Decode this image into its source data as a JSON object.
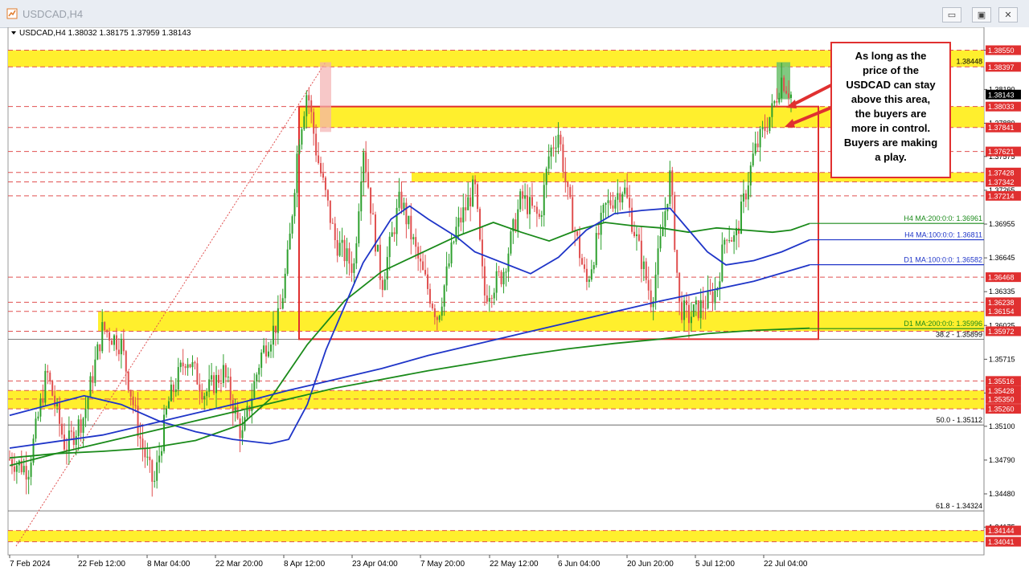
{
  "window": {
    "title": "USDCAD,H4",
    "buttons": {
      "minimize": "▭",
      "restore": "▣",
      "close": "✕"
    }
  },
  "chart_data": {
    "type": "candlestick",
    "symbol_header": "USDCAD,H4  1.38032 1.38175 1.37959 1.38143",
    "ylim": [
      1.3392,
      1.3876
    ],
    "x_ticks": [
      "7 Feb 2024",
      "22 Feb 12:00",
      "8 Mar 04:00",
      "22 Mar 20:00",
      "8 Apr 12:00",
      "23 Apr 04:00",
      "7 May 20:00",
      "22 May 12:00",
      "6 Jun 04:00",
      "20 Jun 20:00",
      "5 Jul 12:00",
      "22 Jul 04:00"
    ],
    "y_ticks": [
      "1.38550",
      "1.38190",
      "1.37880",
      "1.37575",
      "1.37265",
      "1.36955",
      "1.36645",
      "1.36335",
      "1.36025",
      "1.35715",
      "1.35405",
      "1.35100",
      "1.34790",
      "1.34480",
      "1.34175"
    ],
    "price_badges": [
      {
        "label": "1.38550",
        "value": 1.3855,
        "kind": "red"
      },
      {
        "label": "1.38397",
        "value": 1.38397,
        "kind": "red"
      },
      {
        "label": "1.38143",
        "value": 1.38143,
        "kind": "current"
      },
      {
        "label": "1.38033",
        "value": 1.38033,
        "kind": "red"
      },
      {
        "label": "1.37841",
        "value": 1.37841,
        "kind": "red"
      },
      {
        "label": "1.37621",
        "value": 1.37621,
        "kind": "red"
      },
      {
        "label": "1.37428",
        "value": 1.37428,
        "kind": "red"
      },
      {
        "label": "1.37342",
        "value": 1.37342,
        "kind": "red"
      },
      {
        "label": "1.37214",
        "value": 1.37214,
        "kind": "red"
      },
      {
        "label": "1.36468",
        "value": 1.36468,
        "kind": "red"
      },
      {
        "label": "1.36238",
        "value": 1.36238,
        "kind": "red"
      },
      {
        "label": "1.36154",
        "value": 1.36154,
        "kind": "red"
      },
      {
        "label": "1.35972",
        "value": 1.35972,
        "kind": "red"
      },
      {
        "label": "1.35516",
        "value": 1.35516,
        "kind": "red"
      },
      {
        "label": "1.35428",
        "value": 1.35428,
        "kind": "red"
      },
      {
        "label": "1.35350",
        "value": 1.3535,
        "kind": "red"
      },
      {
        "label": "1.35260",
        "value": 1.3526,
        "kind": "red"
      },
      {
        "label": "1.34144",
        "value": 1.34144,
        "kind": "red"
      },
      {
        "label": "1.34041",
        "value": 1.34041,
        "kind": "red"
      }
    ],
    "horizontal_levels": [
      1.3855,
      1.38397,
      1.38033,
      1.37841,
      1.37621,
      1.37428,
      1.37342,
      1.37214,
      1.36468,
      1.36238,
      1.36154,
      1.35972,
      1.35516,
      1.35428,
      1.3535,
      1.3526,
      1.34144,
      1.34041
    ],
    "support_resistance_zones": [
      {
        "from": 1.38397,
        "to": 1.3855
      },
      {
        "from": 1.37841,
        "to": 1.38033
      },
      {
        "from": 1.37342,
        "to": 1.37428
      },
      {
        "from": 1.35972,
        "to": 1.36154
      },
      {
        "from": 1.3526,
        "to": 1.35428
      },
      {
        "from": 1.34041,
        "to": 1.34144
      }
    ],
    "fibonacci_levels": [
      {
        "label": "38.2 - 1.35899",
        "value": 1.35899
      },
      {
        "label": "50.0 - 1.35112",
        "value": 1.35112
      },
      {
        "label": "61.8 - 1.34324",
        "value": 1.34324
      }
    ],
    "high_level_label": "1.38448",
    "moving_averages": [
      {
        "label": "H4 MA:200:0:0: 1.36961",
        "value": 1.36961,
        "color": "#1a8a1a",
        "path": [
          [
            0.0,
            1.3481
          ],
          [
            0.05,
            1.3485
          ],
          [
            0.1,
            1.3487
          ],
          [
            0.15,
            1.349
          ],
          [
            0.2,
            1.3497
          ],
          [
            0.25,
            1.3512
          ],
          [
            0.28,
            1.3535
          ],
          [
            0.3,
            1.356
          ],
          [
            0.32,
            1.3585
          ],
          [
            0.34,
            1.3605
          ],
          [
            0.36,
            1.3625
          ],
          [
            0.4,
            1.3652
          ],
          [
            0.44,
            1.3668
          ],
          [
            0.48,
            1.3684
          ],
          [
            0.52,
            1.3697
          ],
          [
            0.55,
            1.3688
          ],
          [
            0.58,
            1.368
          ],
          [
            0.61,
            1.369
          ],
          [
            0.64,
            1.3697
          ],
          [
            0.67,
            1.3694
          ],
          [
            0.7,
            1.3692
          ],
          [
            0.73,
            1.3688
          ],
          [
            0.76,
            1.3692
          ],
          [
            0.79,
            1.369
          ],
          [
            0.82,
            1.3688
          ],
          [
            0.84,
            1.369
          ],
          [
            0.86,
            1.3696
          ]
        ]
      },
      {
        "label": "H4 MA:100:0:0: 1.36811",
        "value": 1.36811,
        "color": "#1f35c8",
        "path": [
          [
            0.0,
            1.352
          ],
          [
            0.04,
            1.3529
          ],
          [
            0.08,
            1.3538
          ],
          [
            0.12,
            1.353
          ],
          [
            0.16,
            1.3515
          ],
          [
            0.2,
            1.3505
          ],
          [
            0.24,
            1.3498
          ],
          [
            0.28,
            1.3494
          ],
          [
            0.3,
            1.3498
          ],
          [
            0.32,
            1.353
          ],
          [
            0.34,
            1.358
          ],
          [
            0.36,
            1.362
          ],
          [
            0.38,
            1.366
          ],
          [
            0.41,
            1.37
          ],
          [
            0.43,
            1.3712
          ],
          [
            0.45,
            1.37
          ],
          [
            0.48,
            1.3684
          ],
          [
            0.5,
            1.367
          ],
          [
            0.53,
            1.366
          ],
          [
            0.56,
            1.365
          ],
          [
            0.59,
            1.3665
          ],
          [
            0.62,
            1.369
          ],
          [
            0.65,
            1.3705
          ],
          [
            0.68,
            1.3708
          ],
          [
            0.71,
            1.371
          ],
          [
            0.73,
            1.369
          ],
          [
            0.75,
            1.367
          ],
          [
            0.77,
            1.3658
          ],
          [
            0.8,
            1.3662
          ],
          [
            0.83,
            1.367
          ],
          [
            0.86,
            1.3681
          ]
        ]
      },
      {
        "label": "D1 MA:100:0:0: 1.36582",
        "value": 1.36582,
        "color": "#1f35c8",
        "path": [
          [
            0.0,
            1.349
          ],
          [
            0.05,
            1.3496
          ],
          [
            0.1,
            1.3502
          ],
          [
            0.15,
            1.3512
          ],
          [
            0.2,
            1.3522
          ],
          [
            0.25,
            1.3532
          ],
          [
            0.3,
            1.3543
          ],
          [
            0.35,
            1.3553
          ],
          [
            0.4,
            1.3563
          ],
          [
            0.45,
            1.3575
          ],
          [
            0.5,
            1.3585
          ],
          [
            0.55,
            1.3595
          ],
          [
            0.6,
            1.3605
          ],
          [
            0.65,
            1.3615
          ],
          [
            0.7,
            1.3625
          ],
          [
            0.75,
            1.3634
          ],
          [
            0.8,
            1.3643
          ],
          [
            0.86,
            1.3658
          ]
        ]
      },
      {
        "label": "D1 MA:200:0:0: 1.35996",
        "value": 1.35996,
        "color": "#1a8a1a",
        "path": [
          [
            0.0,
            1.3474
          ],
          [
            0.05,
            1.3485
          ],
          [
            0.1,
            1.3495
          ],
          [
            0.15,
            1.3505
          ],
          [
            0.2,
            1.3515
          ],
          [
            0.25,
            1.3525
          ],
          [
            0.3,
            1.3535
          ],
          [
            0.35,
            1.3545
          ],
          [
            0.4,
            1.3553
          ],
          [
            0.45,
            1.3561
          ],
          [
            0.5,
            1.3568
          ],
          [
            0.55,
            1.3575
          ],
          [
            0.6,
            1.3581
          ],
          [
            0.65,
            1.3586
          ],
          [
            0.7,
            1.359
          ],
          [
            0.75,
            1.3595
          ],
          [
            0.8,
            1.3598
          ],
          [
            0.86,
            1.36
          ]
        ]
      }
    ],
    "annotation": "As long as the price of the USDCAD can stay above this area, the buyers are more in control. Buyers are making a play.",
    "series_anchors": [
      [
        0.0,
        1.348
      ],
      [
        0.02,
        1.347
      ],
      [
        0.04,
        1.356
      ],
      [
        0.06,
        1.349
      ],
      [
        0.08,
        1.352
      ],
      [
        0.1,
        1.36
      ],
      [
        0.12,
        1.3585
      ],
      [
        0.14,
        1.35
      ],
      [
        0.155,
        1.3455
      ],
      [
        0.17,
        1.353
      ],
      [
        0.19,
        1.3575
      ],
      [
        0.21,
        1.354
      ],
      [
        0.23,
        1.356
      ],
      [
        0.25,
        1.35
      ],
      [
        0.27,
        1.3575
      ],
      [
        0.29,
        1.361
      ],
      [
        0.3,
        1.367
      ],
      [
        0.31,
        1.377
      ],
      [
        0.32,
        1.382
      ],
      [
        0.33,
        1.376
      ],
      [
        0.34,
        1.372
      ],
      [
        0.35,
        1.368
      ],
      [
        0.37,
        1.3655
      ],
      [
        0.38,
        1.377
      ],
      [
        0.39,
        1.37
      ],
      [
        0.4,
        1.364
      ],
      [
        0.42,
        1.372
      ],
      [
        0.44,
        1.366
      ],
      [
        0.46,
        1.361
      ],
      [
        0.48,
        1.369
      ],
      [
        0.5,
        1.373
      ],
      [
        0.51,
        1.363
      ],
      [
        0.53,
        1.365
      ],
      [
        0.55,
        1.372
      ],
      [
        0.57,
        1.37
      ],
      [
        0.58,
        1.376
      ],
      [
        0.59,
        1.378
      ],
      [
        0.6,
        1.372
      ],
      [
        0.62,
        1.364
      ],
      [
        0.64,
        1.371
      ],
      [
        0.66,
        1.373
      ],
      [
        0.68,
        1.366
      ],
      [
        0.69,
        1.3625
      ],
      [
        0.7,
        1.368
      ],
      [
        0.71,
        1.374
      ],
      [
        0.72,
        1.362
      ],
      [
        0.73,
        1.361
      ],
      [
        0.75,
        1.3625
      ],
      [
        0.76,
        1.3635
      ],
      [
        0.77,
        1.369
      ],
      [
        0.78,
        1.368
      ],
      [
        0.79,
        1.372
      ],
      [
        0.8,
        1.376
      ],
      [
        0.81,
        1.378
      ],
      [
        0.82,
        1.38
      ],
      [
        0.83,
        1.383
      ],
      [
        0.84,
        1.3814
      ]
    ]
  }
}
